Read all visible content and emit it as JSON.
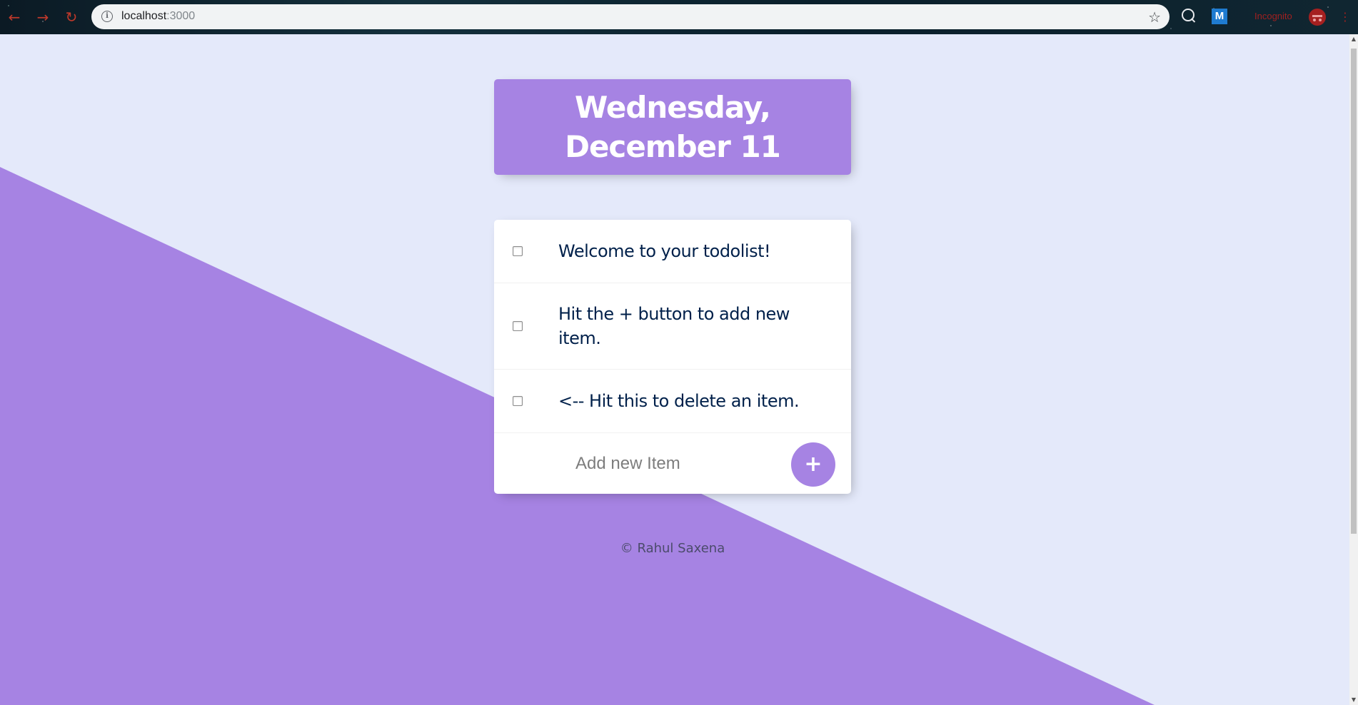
{
  "browser": {
    "url_host": "localhost",
    "url_port": ":3000",
    "incognito_label": "Incognito",
    "extension_label": "M"
  },
  "page": {
    "heading": "Wednesday, December 11",
    "items": [
      {
        "text": "Welcome to your todolist!",
        "checked": false
      },
      {
        "text": "Hit the + button to add new item.",
        "checked": false
      },
      {
        "text": "<-- Hit this to delete an item.",
        "checked": false
      }
    ],
    "new_item_placeholder": "Add new Item",
    "add_button_label": "+",
    "footer": "© Rahul Saxena"
  },
  "colors": {
    "accent": "#A683E3",
    "background": "#E4E9FA",
    "item_text": "#00204A"
  }
}
